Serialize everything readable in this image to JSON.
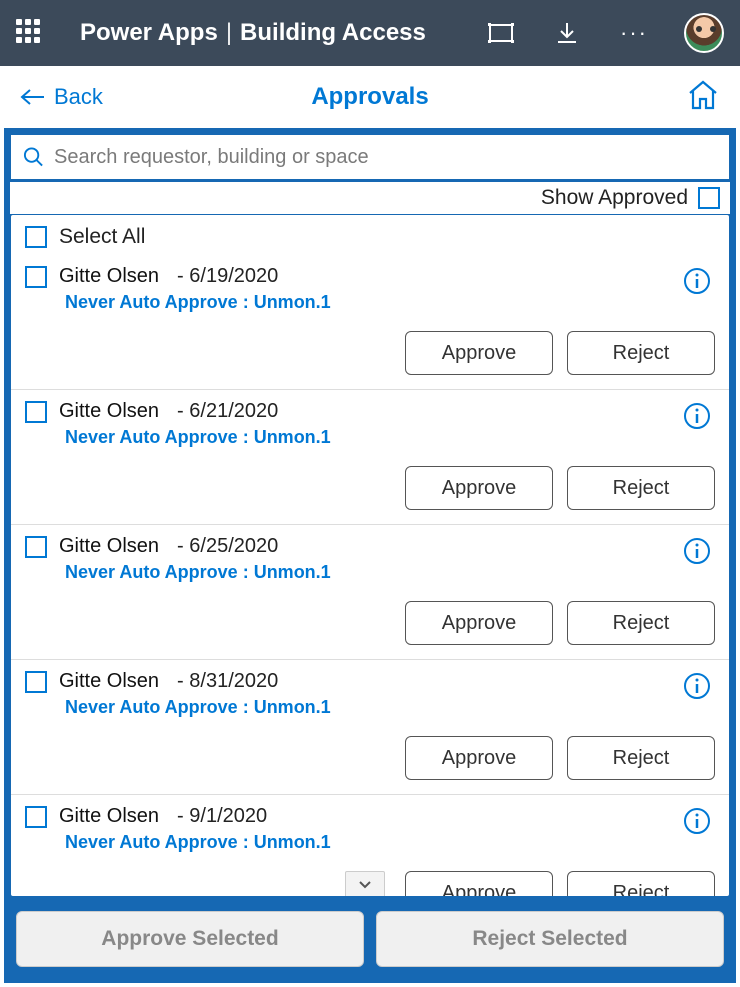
{
  "topbar": {
    "app_name": "Power Apps",
    "divider": "|",
    "app_page": "Building Access"
  },
  "subheader": {
    "back_label": "Back",
    "title": "Approvals"
  },
  "search": {
    "placeholder": "Search requestor, building or space"
  },
  "filters": {
    "show_approved_label": "Show Approved"
  },
  "list": {
    "select_all_label": "Select All",
    "approve_label": "Approve",
    "reject_label": "Reject",
    "items": [
      {
        "name": "Gitte Olsen",
        "date": "- 6/19/2020",
        "sub": "Never Auto Approve : Unmon.1"
      },
      {
        "name": "Gitte Olsen",
        "date": "- 6/21/2020",
        "sub": "Never Auto Approve : Unmon.1"
      },
      {
        "name": "Gitte Olsen",
        "date": "- 6/25/2020",
        "sub": "Never Auto Approve : Unmon.1"
      },
      {
        "name": "Gitte Olsen",
        "date": "- 8/31/2020",
        "sub": "Never Auto Approve : Unmon.1"
      },
      {
        "name": "Gitte Olsen",
        "date": "- 9/1/2020",
        "sub": "Never Auto Approve : Unmon.1"
      }
    ]
  },
  "footer": {
    "approve_selected": "Approve Selected",
    "reject_selected": "Reject Selected"
  }
}
